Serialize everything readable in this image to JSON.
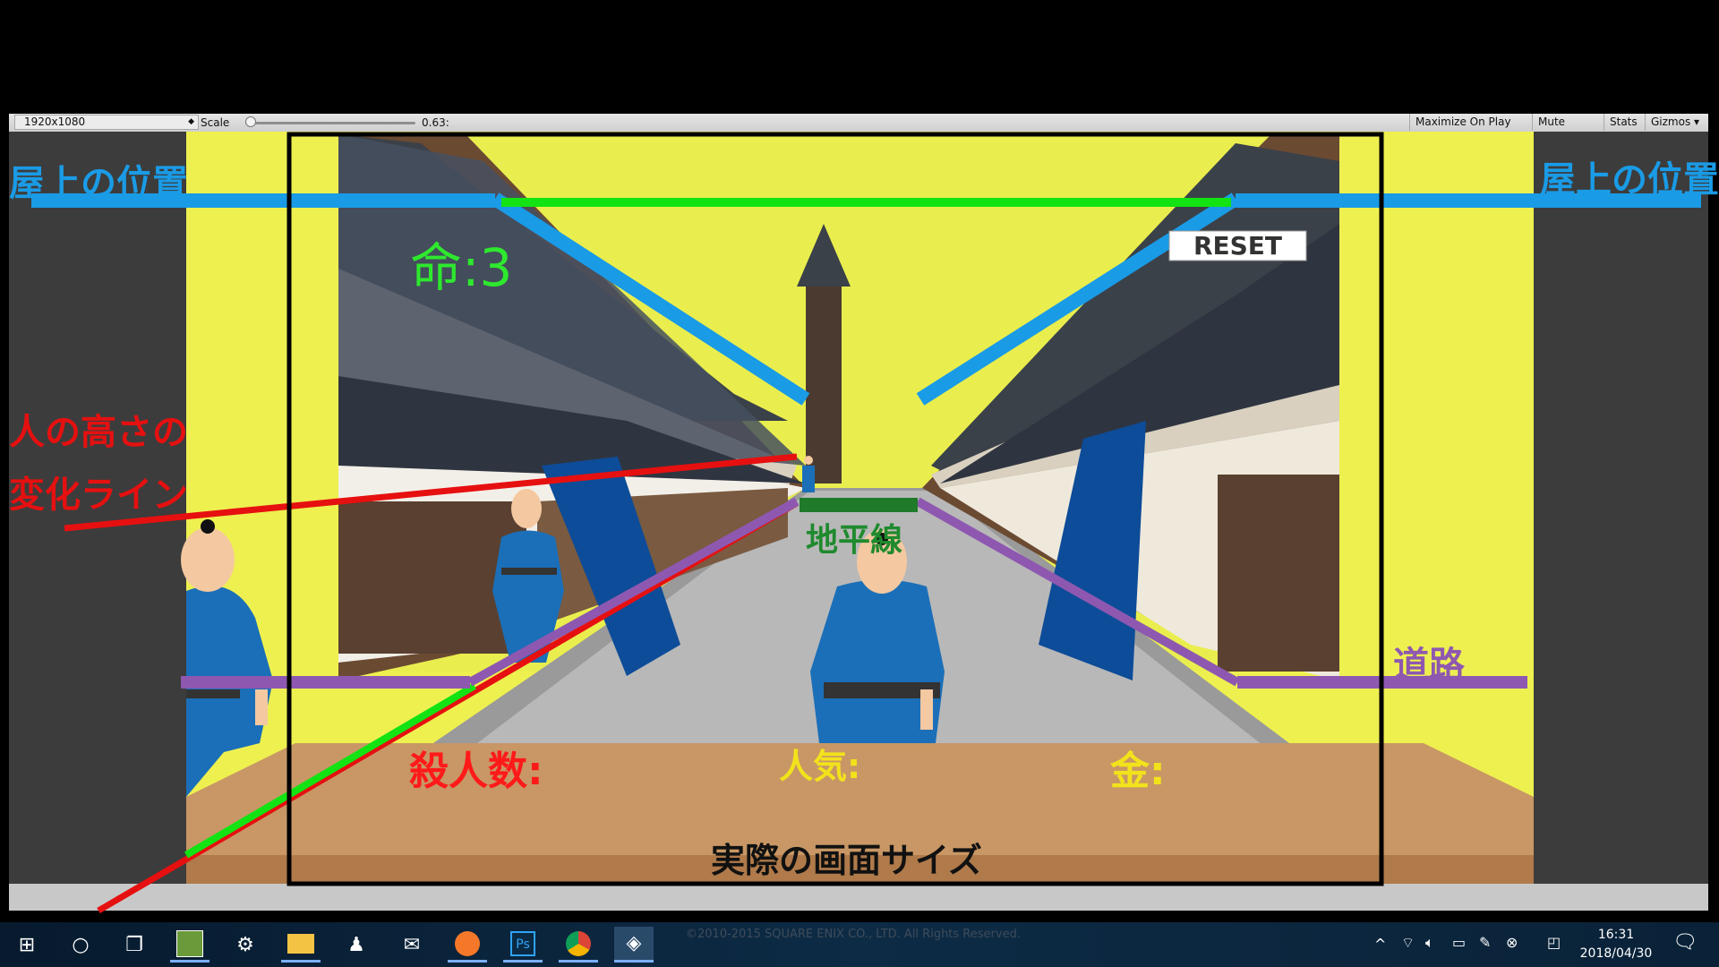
{
  "unity_toolbar": {
    "resolution": "1920x1080",
    "scale_label": "Scale",
    "scale_value": "0.63:",
    "maximize_on_play": "Maximize On Play",
    "mute_audio": "Mute Audio",
    "stats": "Stats",
    "gizmos": "Gizmos"
  },
  "game_ui": {
    "life": "命:3",
    "reset": "RESET",
    "kills": "殺人数:",
    "popularity": "人気:",
    "money": "金:"
  },
  "annotations": {
    "rooftop_left": "屋上の位置",
    "rooftop_right": "屋上の位置",
    "person_height_line_1": "人の高さの",
    "person_height_line_2": "変化ライン",
    "horizon": "地平線",
    "road": "道路",
    "actual_screen_size": "実際の画面サイズ"
  },
  "colors": {
    "rooftop_blue": "#1a9be6",
    "horizon_green": "#13e313",
    "height_red": "#e61010",
    "road_purple": "#8e58b0",
    "frame_black": "#000000",
    "background_yellow": "#eef050",
    "counter_brown": "#c89765"
  },
  "taskbar": {
    "icons": [
      "windows-start-icon",
      "cortana-circle-icon",
      "task-view-icon",
      "game-icon",
      "steam-icon",
      "file-explorer-icon",
      "character-app-icon",
      "mail-icon",
      "firefox-icon",
      "photoshop-icon",
      "chrome-icon",
      "unity-icon"
    ],
    "time": "16:31",
    "date": "2018/04/30",
    "copyright": "©2010-2015 SQUARE ENIX CO., LTD. All Rights Reserved."
  }
}
